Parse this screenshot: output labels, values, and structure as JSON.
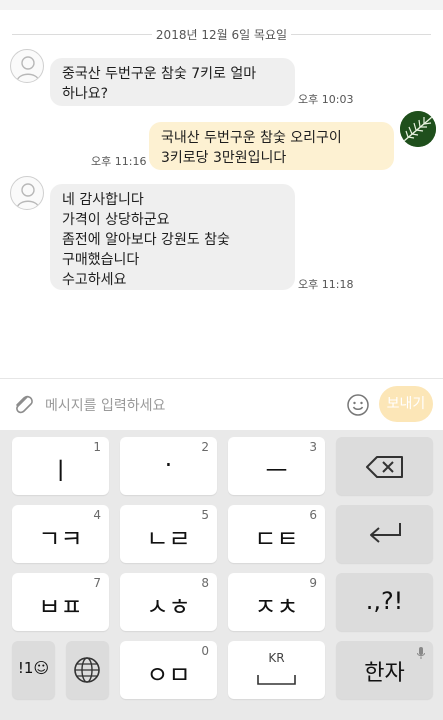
{
  "chat": {
    "date": "2018년 12월 6일 목요일",
    "messages": [
      {
        "sender": "other",
        "text": "중국산 두번구운 참숯 7키로 얼마\n하나요?",
        "time": "오후 10:03"
      },
      {
        "sender": "me",
        "text": "국내산 두번구운 참숯 오리구이\n3키로당 3만원입니다",
        "time": "오후 11:16"
      },
      {
        "sender": "other",
        "text": "네 감사합니다\n가격이 상당하군요\n좀전에 알아보다 강원도 참숯\n구매했습니다\n수고하세요",
        "time": "오후 11:18"
      }
    ]
  },
  "input": {
    "placeholder": "메시지를 입력하세요",
    "send_label": "보내기"
  },
  "keyboard": {
    "keys": [
      {
        "label": "ㅣ",
        "num": "1"
      },
      {
        "label": "·",
        "num": "2"
      },
      {
        "label": "ㅡ",
        "num": "3"
      },
      {
        "label": "ㄱㅋ",
        "num": "4"
      },
      {
        "label": "ㄴㄹ",
        "num": "5"
      },
      {
        "label": "ㄷㅌ",
        "num": "6"
      },
      {
        "label": "ㅂㅍ",
        "num": "7"
      },
      {
        "label": "ㅅㅎ",
        "num": "8"
      },
      {
        "label": "ㅈㅊ",
        "num": "9"
      },
      {
        "label": ".,?!"
      },
      {
        "label": "!1☺"
      },
      {
        "label": "ㅇㅁ",
        "num": "0"
      },
      {
        "label": "KR"
      },
      {
        "label": "한자"
      }
    ]
  },
  "colors": {
    "incoming_bubble": "#efefef",
    "outgoing_bubble": "#fdf1d2",
    "send_button": "#fce6b7",
    "keyboard_bg": "#e9e9e9"
  },
  "icons": [
    "person-avatar-icon",
    "fern-avatar-icon",
    "paperclip-icon",
    "smiley-icon",
    "backspace-icon",
    "enter-icon",
    "globe-icon",
    "space-icon",
    "mic-icon"
  ]
}
